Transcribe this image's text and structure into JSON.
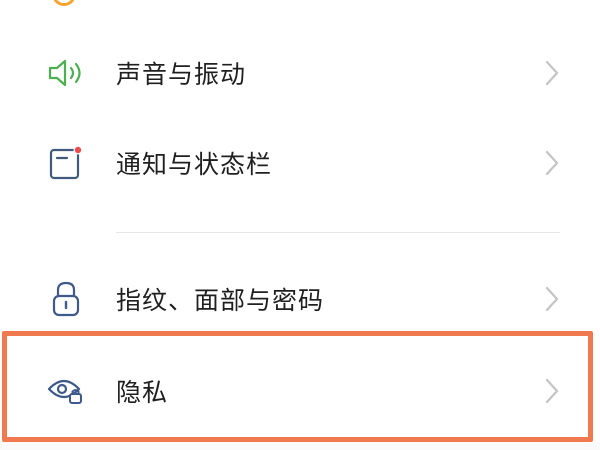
{
  "settings": {
    "items": [
      {
        "label": "声音与振动",
        "icon": "speaker-icon",
        "icon_color": "#4caf50"
      },
      {
        "label": "通知与状态栏",
        "icon": "notification-icon",
        "icon_color": "#3f5a7a",
        "badge_color": "#e94e4e"
      },
      {
        "label": "指纹、面部与密码",
        "icon": "lock-icon",
        "icon_color": "#3f5a8a"
      },
      {
        "label": "隐私",
        "icon": "privacy-eye-icon",
        "icon_color": "#3f5a8a"
      }
    ]
  },
  "highlight": {
    "color": "#ef7a4f",
    "target": "隐私"
  }
}
